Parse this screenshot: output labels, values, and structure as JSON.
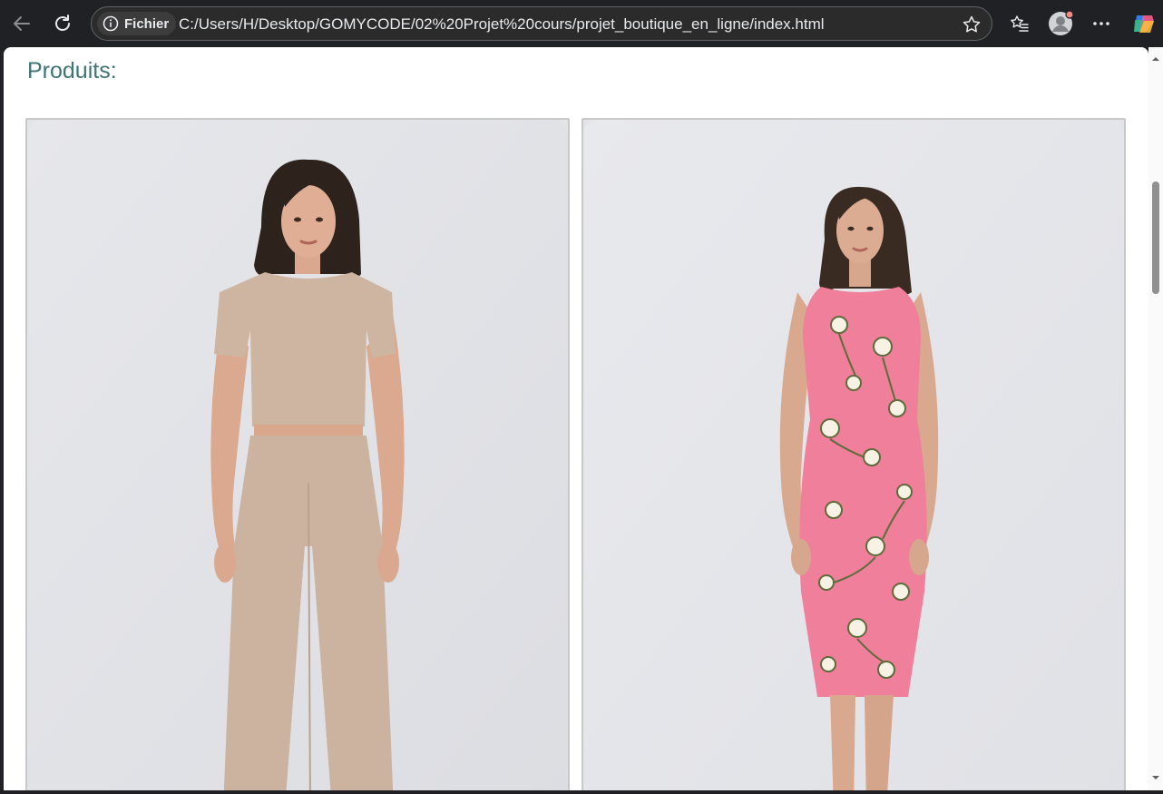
{
  "browser": {
    "site_chip_label": "Fichier",
    "url": "C:/Users/H/Desktop/GOMYCODE/02%20Projet%20cours/projet_boutique_en_ligne/index.html",
    "accent_color": "#3e7474"
  },
  "page": {
    "heading": "Produits:"
  },
  "products": [
    {
      "name": "beige-top-and-wide-pants-set",
      "colors": {
        "background": "#e4e5e9",
        "outfit": "#cdb5a1",
        "skin": "#dfae94",
        "hair": "#2e221d"
      }
    },
    {
      "name": "pink-floral-sleeveless-dress",
      "colors": {
        "background": "#e6e7ec",
        "outfit": "#ef7f9a",
        "print": "#5e6b3a",
        "skin": "#dcac92",
        "hair": "#3a2b22"
      }
    }
  ]
}
